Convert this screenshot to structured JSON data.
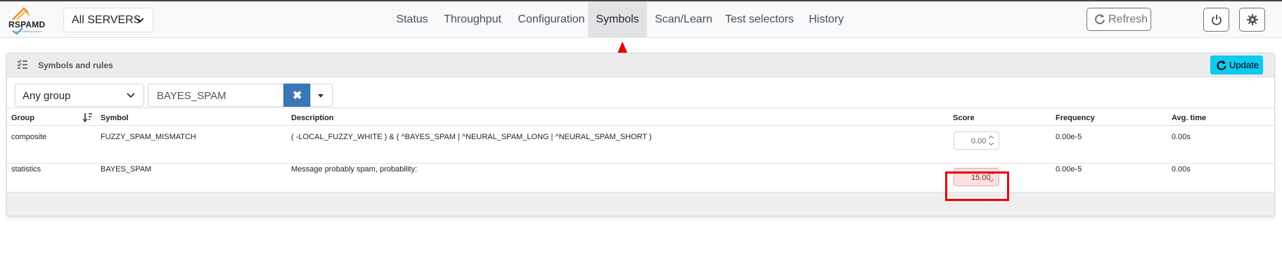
{
  "app": {
    "logo_text": "RSPAMD",
    "logo_sub": "spam filtering system"
  },
  "server_selector": {
    "value": "All SERVERS"
  },
  "nav": {
    "items": [
      {
        "label": "Status"
      },
      {
        "label": "Throughput"
      },
      {
        "label": "Configuration"
      },
      {
        "label": "Symbols",
        "active": true
      },
      {
        "label": "Scan/Learn"
      },
      {
        "label": "Test selectors"
      },
      {
        "label": "History"
      }
    ],
    "refresh_label": "Refresh"
  },
  "card": {
    "title": "Symbols and rules",
    "update_label": "Update"
  },
  "filters": {
    "group_value": "Any group",
    "search_value": "BAYES_SPAM",
    "clear_symbol": "✖"
  },
  "table": {
    "headers": [
      "Group",
      "Symbol",
      "Description",
      "Score",
      "Frequency",
      "Avg. time"
    ],
    "rows": [
      {
        "group": "composite",
        "symbol": "FUZZY_SPAM_MISMATCH",
        "description": "( -LOCAL_FUZZY_WHITE ) & ( ^BAYES_SPAM | ^NEURAL_SPAM_LONG | ^NEURAL_SPAM_SHORT )",
        "score": "0.00",
        "frequency": "0.00e-5",
        "avg_time": "0.00s"
      },
      {
        "group": "statistics",
        "symbol": "BAYES_SPAM",
        "description": "Message probably spam, probability:",
        "score": "15.00",
        "frequency": "0.00e-5",
        "avg_time": "0.00s"
      }
    ]
  },
  "colors": {
    "annotation": "#e8000b",
    "accent_update": "#0dcaf0",
    "clear_button": "#3a78b5"
  }
}
